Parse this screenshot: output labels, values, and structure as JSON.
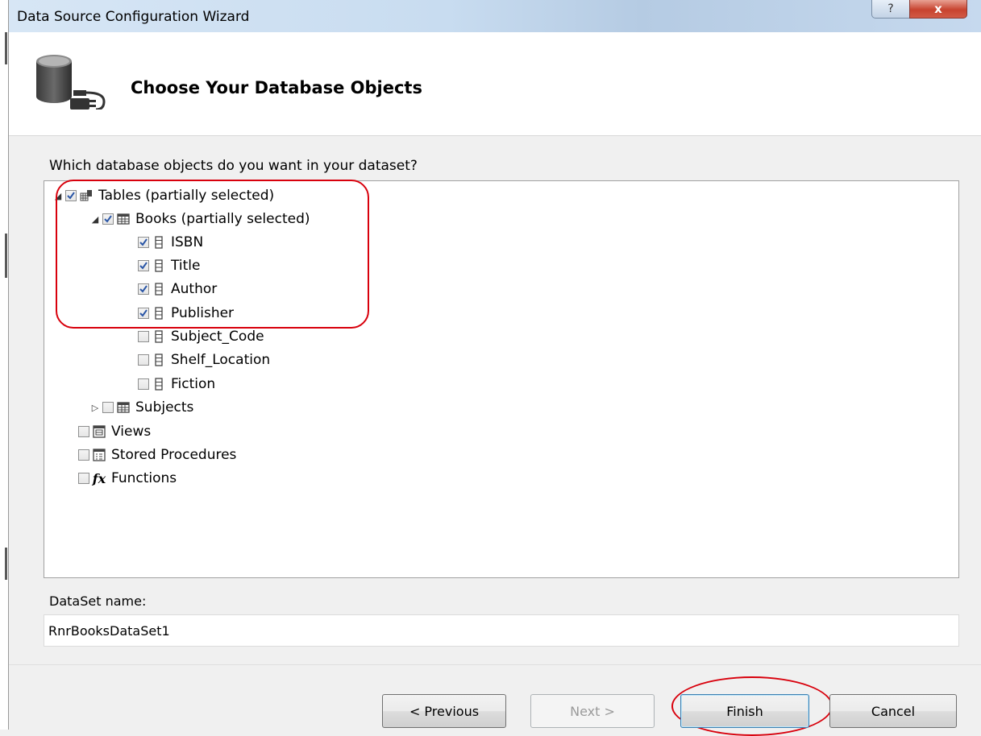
{
  "window": {
    "title": "Data Source Configuration Wizard",
    "help_glyph": "?",
    "close_glyph": "x"
  },
  "header": {
    "title": "Choose Your Database Objects",
    "icon": "database-plug-icon"
  },
  "prompt": "Which database objects do you want in your dataset?",
  "tree": {
    "tables": {
      "label": "Tables (partially selected)",
      "checked": true,
      "expanded": true,
      "books": {
        "label": "Books (partially selected)",
        "checked": true,
        "expanded": true,
        "columns": [
          {
            "label": "ISBN",
            "checked": true
          },
          {
            "label": "Title",
            "checked": true
          },
          {
            "label": "Author",
            "checked": true
          },
          {
            "label": "Publisher",
            "checked": true
          },
          {
            "label": "Subject_Code",
            "checked": false
          },
          {
            "label": "Shelf_Location",
            "checked": false
          },
          {
            "label": "Fiction",
            "checked": false
          }
        ]
      },
      "subjects": {
        "label": "Subjects",
        "checked": false,
        "expanded": false
      }
    },
    "views": {
      "label": "Views",
      "checked": false
    },
    "stored_procedures": {
      "label": "Stored Procedures",
      "checked": false
    },
    "functions": {
      "label": "Functions",
      "checked": false,
      "icon_text": "fx"
    }
  },
  "dataset": {
    "label": "DataSet name:",
    "value": "RnrBooksDataSet1"
  },
  "buttons": {
    "previous": "< Previous",
    "next": "Next >",
    "finish": "Finish",
    "cancel": "Cancel"
  },
  "colors": {
    "annotation": "#d8000c",
    "checkmark": "#2a56a6"
  }
}
